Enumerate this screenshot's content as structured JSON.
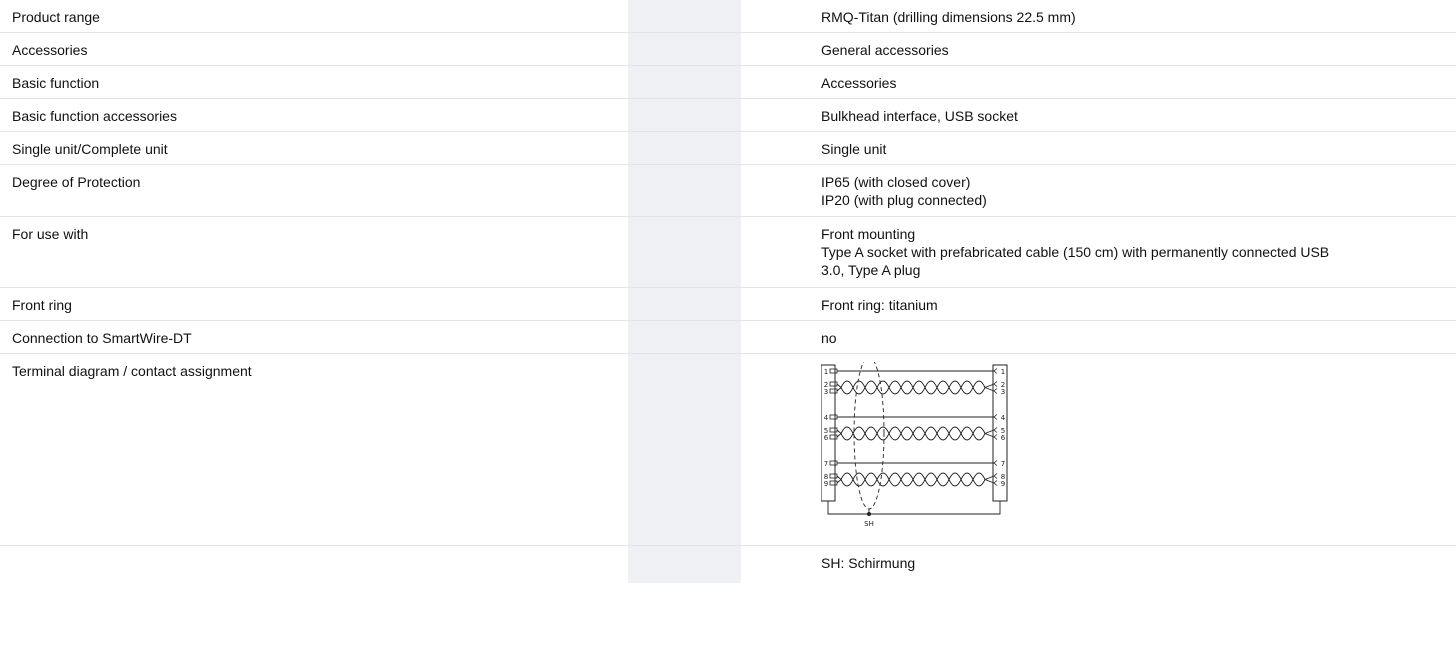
{
  "rows": [
    {
      "label": "Product range",
      "value": [
        "RMQ-Titan (drilling dimensions 22.5 mm)"
      ]
    },
    {
      "label": "Accessories",
      "value": [
        "General accessories"
      ]
    },
    {
      "label": "Basic function",
      "value": [
        "Accessories"
      ]
    },
    {
      "label": "Basic function accessories",
      "value": [
        "Bulkhead interface, USB socket"
      ]
    },
    {
      "label": "Single unit/Complete unit",
      "value": [
        "Single unit"
      ]
    },
    {
      "label": "Degree of Protection",
      "value": [
        "IP65 (with closed cover)",
        "IP20 (with plug connected)"
      ]
    },
    {
      "label": "For use with",
      "value": [
        "Front mounting",
        "Type A socket with prefabricated cable (150 cm) with permanently connected USB",
        "3.0, Type A plug"
      ]
    },
    {
      "label": "Front ring",
      "value": [
        "Front ring: titanium"
      ]
    },
    {
      "label": "Connection to SmartWire-DT",
      "value": [
        "no"
      ]
    },
    {
      "label": "Terminal diagram / contact assignment",
      "value": []
    },
    {
      "label": "",
      "value": [
        "SH: Schirmung"
      ]
    }
  ],
  "diagram": {
    "left_pins": [
      "1",
      "2",
      "3",
      "4",
      "5",
      "6",
      "7",
      "8",
      "9"
    ],
    "right_pins": [
      "1",
      "2",
      "3",
      "4",
      "5",
      "6",
      "7",
      "8",
      "9"
    ],
    "shield_label": "SH"
  }
}
